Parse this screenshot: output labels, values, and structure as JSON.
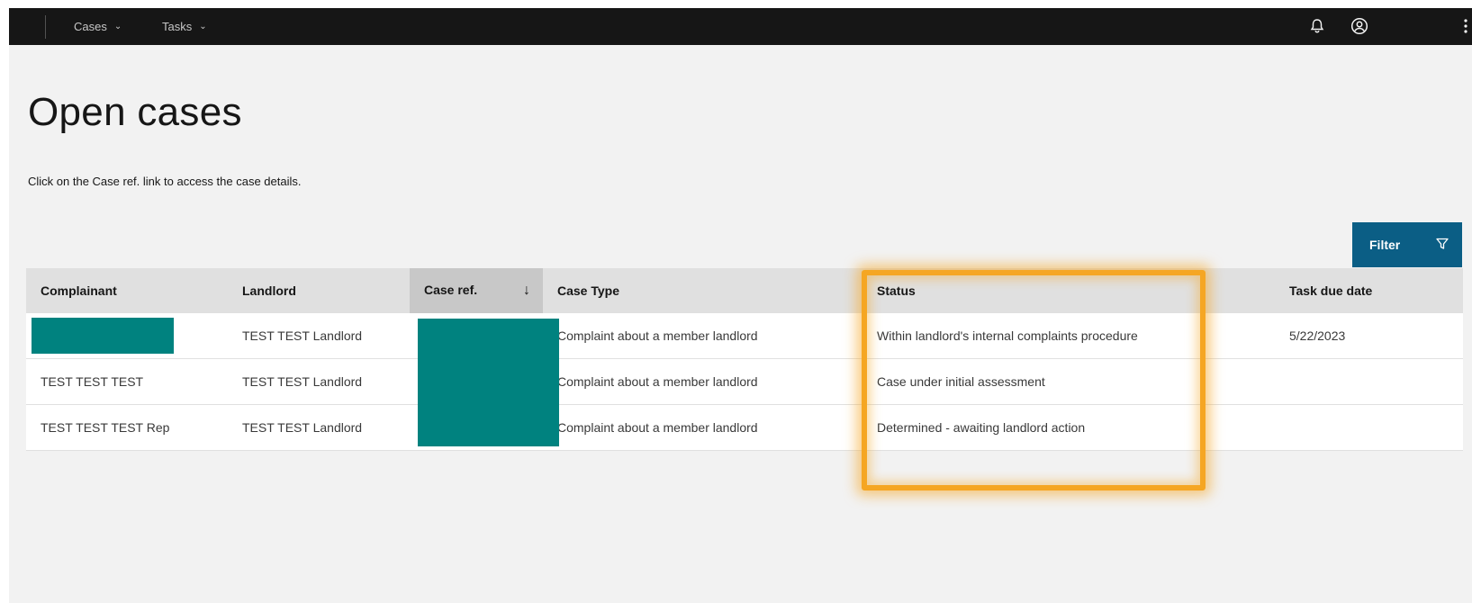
{
  "nav": {
    "items": [
      {
        "label": "Cases"
      },
      {
        "label": "Tasks"
      }
    ],
    "icons": [
      "bell-icon",
      "user-avatar-icon",
      "overflow-menu-icon"
    ]
  },
  "page": {
    "title": "Open cases",
    "helper": "Click on the Case ref. link to access the case details."
  },
  "filter": {
    "label": "Filter"
  },
  "table": {
    "headers": [
      "Complainant",
      "Landlord",
      "Case ref.",
      "Case Type",
      "Status",
      "Task due date"
    ],
    "rows": [
      {
        "complainant": "",
        "landlord": "TEST TEST Landlord",
        "case_ref": "",
        "case_type": "Complaint about a member landlord",
        "status": "Within landlord's internal complaints procedure",
        "due": "5/22/2023"
      },
      {
        "complainant": "TEST TEST TEST",
        "landlord": "TEST TEST Landlord",
        "case_ref": "",
        "case_type": "Complaint about a member landlord",
        "status": "Case under initial assessment",
        "due": ""
      },
      {
        "complainant": "TEST TEST TEST Rep",
        "landlord": "TEST TEST Landlord",
        "case_ref": "",
        "case_type": "Complaint about a member landlord",
        "status": "Determined - awaiting landlord action",
        "due": ""
      }
    ]
  },
  "colors": {
    "topbar": "#161616",
    "filter_button": "#0b5e85",
    "redaction": "#00827f",
    "highlight": "#f5a623"
  }
}
